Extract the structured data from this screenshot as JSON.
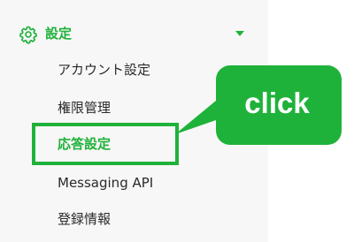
{
  "section": {
    "title": "設定",
    "icon": "gear-icon",
    "expand_icon": "chevron-down-icon"
  },
  "menu": {
    "items": [
      {
        "label": "アカウント設定"
      },
      {
        "label": "権限管理"
      },
      {
        "label": "応答設定",
        "active": true
      },
      {
        "label": "Messaging API"
      },
      {
        "label": "登録情報"
      }
    ]
  },
  "callout": {
    "label": "click"
  },
  "colors": {
    "accent": "#1fb23a",
    "sidebar_bg": "#f7f7f7",
    "text": "#2a2a2a"
  }
}
